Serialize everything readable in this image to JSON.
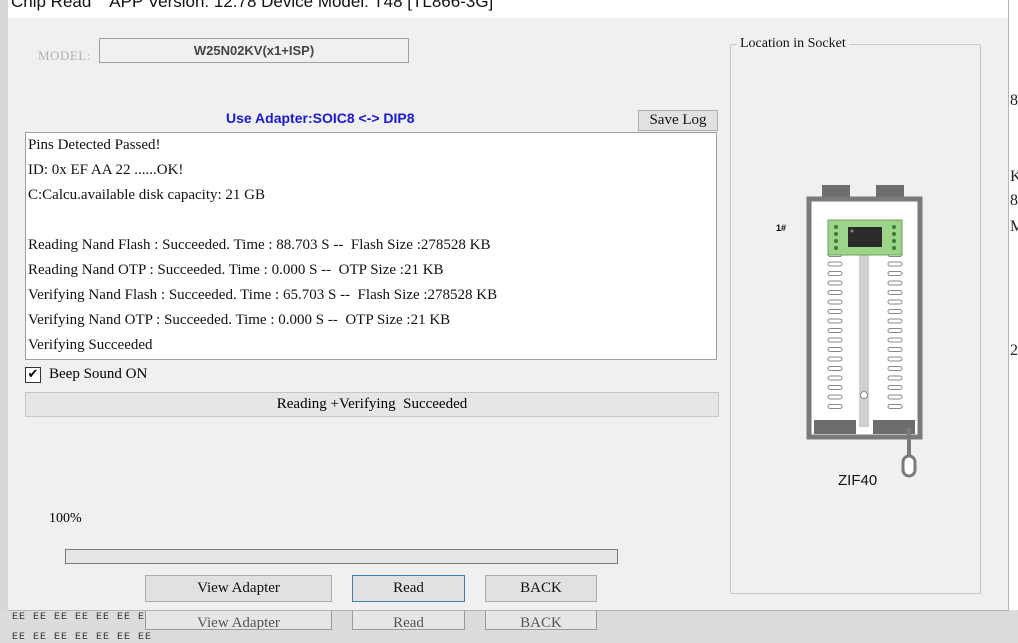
{
  "window": {
    "title": "Chip Read    APP Version: 12.78 Device Model: T48 [TL866-3G]"
  },
  "model": {
    "label": "MODEL:",
    "value": "W25N02KV(x1+ISP)"
  },
  "adapter_text": "Use Adapter:SOIC8 <-> DIP8",
  "buttons": {
    "save_log": "Save Log",
    "view_adapter": "View Adapter",
    "read": "Read",
    "back": "BACK"
  },
  "log_lines": [
    "Pins Detected Passed!",
    "ID: 0x EF AA 22 ......OK!",
    "C:Calcu.available disk capacity: 21 GB",
    "",
    "Reading Nand Flash : Succeeded. Time : 88.703 S --  Flash Size :278528 KB",
    "Reading Nand OTP : Succeeded. Time : 0.000 S --  OTP Size :21 KB",
    "Verifying Nand Flash : Succeeded. Time : 65.703 S --  Flash Size :278528 KB",
    "Verifying Nand OTP : Succeeded. Time : 0.000 S --  OTP Size :21 KB",
    "Verifying Succeeded"
  ],
  "beep": {
    "checked": true,
    "check_glyph": "✔",
    "label": "Beep Sound ON"
  },
  "status": "Reading +Verifying  Succeeded",
  "progress": {
    "label": "100%",
    "value": 1.0
  },
  "socket": {
    "title": "Location in Socket",
    "pin1_label": "1#",
    "socket_label": "ZIF40"
  },
  "background": {
    "right_glyphs": [
      "8",
      "K",
      "8",
      "M",
      "2"
    ],
    "bottom_buttons": [
      "View Adapter",
      "Read",
      "BACK"
    ],
    "grid_mark": "EE EE EE EE EE EE EE"
  },
  "colors": {
    "adapter_text": "#1a1ad0",
    "dialog_bg": "#f0f0f0",
    "chip_green": "#9ed48a"
  }
}
